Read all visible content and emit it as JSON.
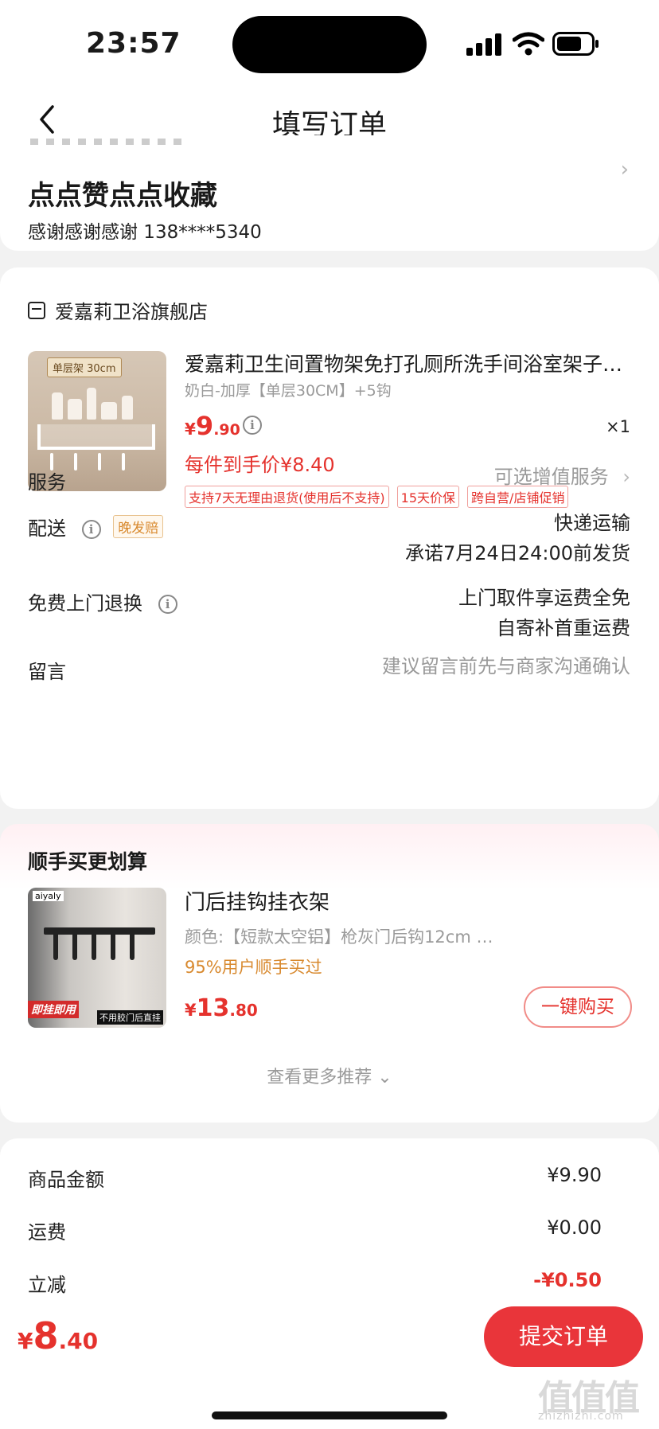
{
  "status": {
    "time": "23:57"
  },
  "nav": {
    "title": "填写订单"
  },
  "address": {
    "name": "点点赞点点收藏",
    "contact": "感谢感谢感谢  138****5340"
  },
  "shop": {
    "name": "爱嘉莉卫浴旗舰店"
  },
  "product": {
    "title": "爱嘉莉卫生间置物架免打孔厕所洗手间浴室架子…",
    "spec": "奶白-加厚【单层30CM】+5钩",
    "image_tag": "单层架 30cm",
    "price_yen": "¥",
    "price_int": "9",
    "price_dec": ".90",
    "qty": "×1",
    "net_price": "每件到手价¥8.40",
    "tags": [
      "支持7天无理由退货(使用后不支持)",
      "15天价保",
      "跨自营/店铺促销"
    ]
  },
  "rows": {
    "service": {
      "label": "服务",
      "value": "可选增值服务",
      "chevron": "›"
    },
    "delivery": {
      "label": "配送",
      "badge": "晚发赔",
      "value1": "快递运输",
      "value2": "承诺7月24日24:00前发货"
    },
    "return": {
      "label": "免费上门退换",
      "value1": "上门取件享运费全免",
      "value2": "自寄补首重运费"
    },
    "message": {
      "label": "留言",
      "placeholder": "建议留言前先与商家沟通确认"
    }
  },
  "recommend": {
    "title": "顺手买更划算",
    "item": {
      "name": "门后挂钩挂衣架",
      "spec": "颜色:【短款太空铝】枪灰门后钩12cm  …",
      "buyers": "95%用户顺手买过",
      "price_yen": "¥",
      "price_int": "13",
      "price_dec": ".80",
      "button": "一键购买",
      "image_logo": "aiyaly",
      "image_label_a": "即挂即用",
      "image_label_b": "不用胶门后直挂"
    },
    "more": "查看更多推荐 ⌄"
  },
  "summary": {
    "goods_label": "商品金额",
    "goods_value": "¥9.90",
    "ship_label": "运费",
    "ship_value": "¥0.00",
    "discount_label": "立减",
    "discount_value": "-¥0.50"
  },
  "bottom": {
    "total_yen": "¥",
    "total_int": "8",
    "total_dec": ".40",
    "submit": "提交订单",
    "watermark": "值值值",
    "watermark_url": "zhizhizhi.com"
  },
  "colors": {
    "accent": "#e5322d",
    "submit_bg": "#e9353a",
    "muted": "#9a9a9a",
    "orange": "#d8892e"
  }
}
